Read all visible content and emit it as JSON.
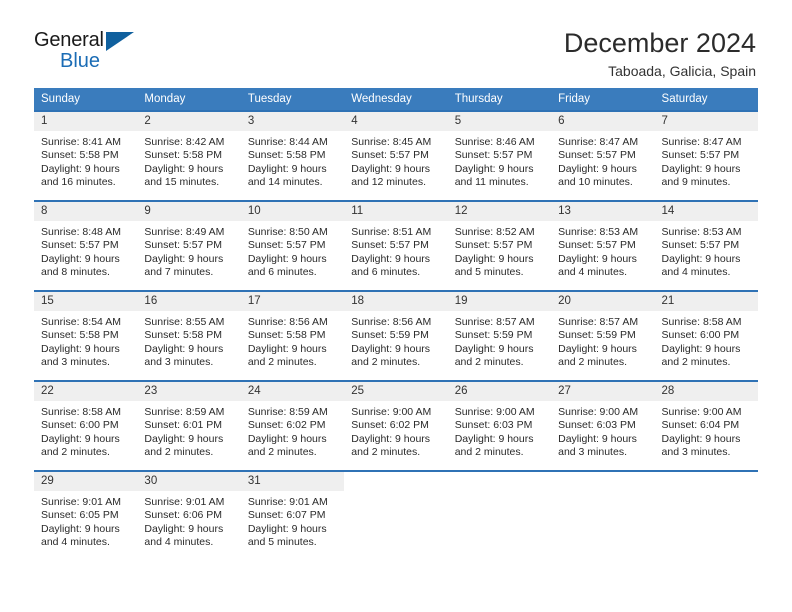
{
  "brand": {
    "name_part1": "General",
    "name_part2": "Blue",
    "accent_color": "#10609e"
  },
  "header": {
    "title": "December 2024",
    "subtitle": "Taboada, Galicia, Spain"
  },
  "calendar": {
    "header_bg": "#3a7cbd",
    "row_divider_color": "#2f72b5",
    "weekday_headers": [
      "Sunday",
      "Monday",
      "Tuesday",
      "Wednesday",
      "Thursday",
      "Friday",
      "Saturday"
    ],
    "weeks": [
      [
        {
          "day": "1",
          "sunrise": "Sunrise: 8:41 AM",
          "sunset": "Sunset: 5:58 PM",
          "daylight_line1": "Daylight: 9 hours",
          "daylight_line2": "and 16 minutes."
        },
        {
          "day": "2",
          "sunrise": "Sunrise: 8:42 AM",
          "sunset": "Sunset: 5:58 PM",
          "daylight_line1": "Daylight: 9 hours",
          "daylight_line2": "and 15 minutes."
        },
        {
          "day": "3",
          "sunrise": "Sunrise: 8:44 AM",
          "sunset": "Sunset: 5:58 PM",
          "daylight_line1": "Daylight: 9 hours",
          "daylight_line2": "and 14 minutes."
        },
        {
          "day": "4",
          "sunrise": "Sunrise: 8:45 AM",
          "sunset": "Sunset: 5:57 PM",
          "daylight_line1": "Daylight: 9 hours",
          "daylight_line2": "and 12 minutes."
        },
        {
          "day": "5",
          "sunrise": "Sunrise: 8:46 AM",
          "sunset": "Sunset: 5:57 PM",
          "daylight_line1": "Daylight: 9 hours",
          "daylight_line2": "and 11 minutes."
        },
        {
          "day": "6",
          "sunrise": "Sunrise: 8:47 AM",
          "sunset": "Sunset: 5:57 PM",
          "daylight_line1": "Daylight: 9 hours",
          "daylight_line2": "and 10 minutes."
        },
        {
          "day": "7",
          "sunrise": "Sunrise: 8:47 AM",
          "sunset": "Sunset: 5:57 PM",
          "daylight_line1": "Daylight: 9 hours",
          "daylight_line2": "and 9 minutes."
        }
      ],
      [
        {
          "day": "8",
          "sunrise": "Sunrise: 8:48 AM",
          "sunset": "Sunset: 5:57 PM",
          "daylight_line1": "Daylight: 9 hours",
          "daylight_line2": "and 8 minutes."
        },
        {
          "day": "9",
          "sunrise": "Sunrise: 8:49 AM",
          "sunset": "Sunset: 5:57 PM",
          "daylight_line1": "Daylight: 9 hours",
          "daylight_line2": "and 7 minutes."
        },
        {
          "day": "10",
          "sunrise": "Sunrise: 8:50 AM",
          "sunset": "Sunset: 5:57 PM",
          "daylight_line1": "Daylight: 9 hours",
          "daylight_line2": "and 6 minutes."
        },
        {
          "day": "11",
          "sunrise": "Sunrise: 8:51 AM",
          "sunset": "Sunset: 5:57 PM",
          "daylight_line1": "Daylight: 9 hours",
          "daylight_line2": "and 6 minutes."
        },
        {
          "day": "12",
          "sunrise": "Sunrise: 8:52 AM",
          "sunset": "Sunset: 5:57 PM",
          "daylight_line1": "Daylight: 9 hours",
          "daylight_line2": "and 5 minutes."
        },
        {
          "day": "13",
          "sunrise": "Sunrise: 8:53 AM",
          "sunset": "Sunset: 5:57 PM",
          "daylight_line1": "Daylight: 9 hours",
          "daylight_line2": "and 4 minutes."
        },
        {
          "day": "14",
          "sunrise": "Sunrise: 8:53 AM",
          "sunset": "Sunset: 5:57 PM",
          "daylight_line1": "Daylight: 9 hours",
          "daylight_line2": "and 4 minutes."
        }
      ],
      [
        {
          "day": "15",
          "sunrise": "Sunrise: 8:54 AM",
          "sunset": "Sunset: 5:58 PM",
          "daylight_line1": "Daylight: 9 hours",
          "daylight_line2": "and 3 minutes."
        },
        {
          "day": "16",
          "sunrise": "Sunrise: 8:55 AM",
          "sunset": "Sunset: 5:58 PM",
          "daylight_line1": "Daylight: 9 hours",
          "daylight_line2": "and 3 minutes."
        },
        {
          "day": "17",
          "sunrise": "Sunrise: 8:56 AM",
          "sunset": "Sunset: 5:58 PM",
          "daylight_line1": "Daylight: 9 hours",
          "daylight_line2": "and 2 minutes."
        },
        {
          "day": "18",
          "sunrise": "Sunrise: 8:56 AM",
          "sunset": "Sunset: 5:59 PM",
          "daylight_line1": "Daylight: 9 hours",
          "daylight_line2": "and 2 minutes."
        },
        {
          "day": "19",
          "sunrise": "Sunrise: 8:57 AM",
          "sunset": "Sunset: 5:59 PM",
          "daylight_line1": "Daylight: 9 hours",
          "daylight_line2": "and 2 minutes."
        },
        {
          "day": "20",
          "sunrise": "Sunrise: 8:57 AM",
          "sunset": "Sunset: 5:59 PM",
          "daylight_line1": "Daylight: 9 hours",
          "daylight_line2": "and 2 minutes."
        },
        {
          "day": "21",
          "sunrise": "Sunrise: 8:58 AM",
          "sunset": "Sunset: 6:00 PM",
          "daylight_line1": "Daylight: 9 hours",
          "daylight_line2": "and 2 minutes."
        }
      ],
      [
        {
          "day": "22",
          "sunrise": "Sunrise: 8:58 AM",
          "sunset": "Sunset: 6:00 PM",
          "daylight_line1": "Daylight: 9 hours",
          "daylight_line2": "and 2 minutes."
        },
        {
          "day": "23",
          "sunrise": "Sunrise: 8:59 AM",
          "sunset": "Sunset: 6:01 PM",
          "daylight_line1": "Daylight: 9 hours",
          "daylight_line2": "and 2 minutes."
        },
        {
          "day": "24",
          "sunrise": "Sunrise: 8:59 AM",
          "sunset": "Sunset: 6:02 PM",
          "daylight_line1": "Daylight: 9 hours",
          "daylight_line2": "and 2 minutes."
        },
        {
          "day": "25",
          "sunrise": "Sunrise: 9:00 AM",
          "sunset": "Sunset: 6:02 PM",
          "daylight_line1": "Daylight: 9 hours",
          "daylight_line2": "and 2 minutes."
        },
        {
          "day": "26",
          "sunrise": "Sunrise: 9:00 AM",
          "sunset": "Sunset: 6:03 PM",
          "daylight_line1": "Daylight: 9 hours",
          "daylight_line2": "and 2 minutes."
        },
        {
          "day": "27",
          "sunrise": "Sunrise: 9:00 AM",
          "sunset": "Sunset: 6:03 PM",
          "daylight_line1": "Daylight: 9 hours",
          "daylight_line2": "and 3 minutes."
        },
        {
          "day": "28",
          "sunrise": "Sunrise: 9:00 AM",
          "sunset": "Sunset: 6:04 PM",
          "daylight_line1": "Daylight: 9 hours",
          "daylight_line2": "and 3 minutes."
        }
      ],
      [
        {
          "day": "29",
          "sunrise": "Sunrise: 9:01 AM",
          "sunset": "Sunset: 6:05 PM",
          "daylight_line1": "Daylight: 9 hours",
          "daylight_line2": "and 4 minutes."
        },
        {
          "day": "30",
          "sunrise": "Sunrise: 9:01 AM",
          "sunset": "Sunset: 6:06 PM",
          "daylight_line1": "Daylight: 9 hours",
          "daylight_line2": "and 4 minutes."
        },
        {
          "day": "31",
          "sunrise": "Sunrise: 9:01 AM",
          "sunset": "Sunset: 6:07 PM",
          "daylight_line1": "Daylight: 9 hours",
          "daylight_line2": "and 5 minutes."
        },
        {
          "day": "",
          "sunrise": "",
          "sunset": "",
          "daylight_line1": "",
          "daylight_line2": ""
        },
        {
          "day": "",
          "sunrise": "",
          "sunset": "",
          "daylight_line1": "",
          "daylight_line2": ""
        },
        {
          "day": "",
          "sunrise": "",
          "sunset": "",
          "daylight_line1": "",
          "daylight_line2": ""
        },
        {
          "day": "",
          "sunrise": "",
          "sunset": "",
          "daylight_line1": "",
          "daylight_line2": ""
        }
      ]
    ]
  }
}
